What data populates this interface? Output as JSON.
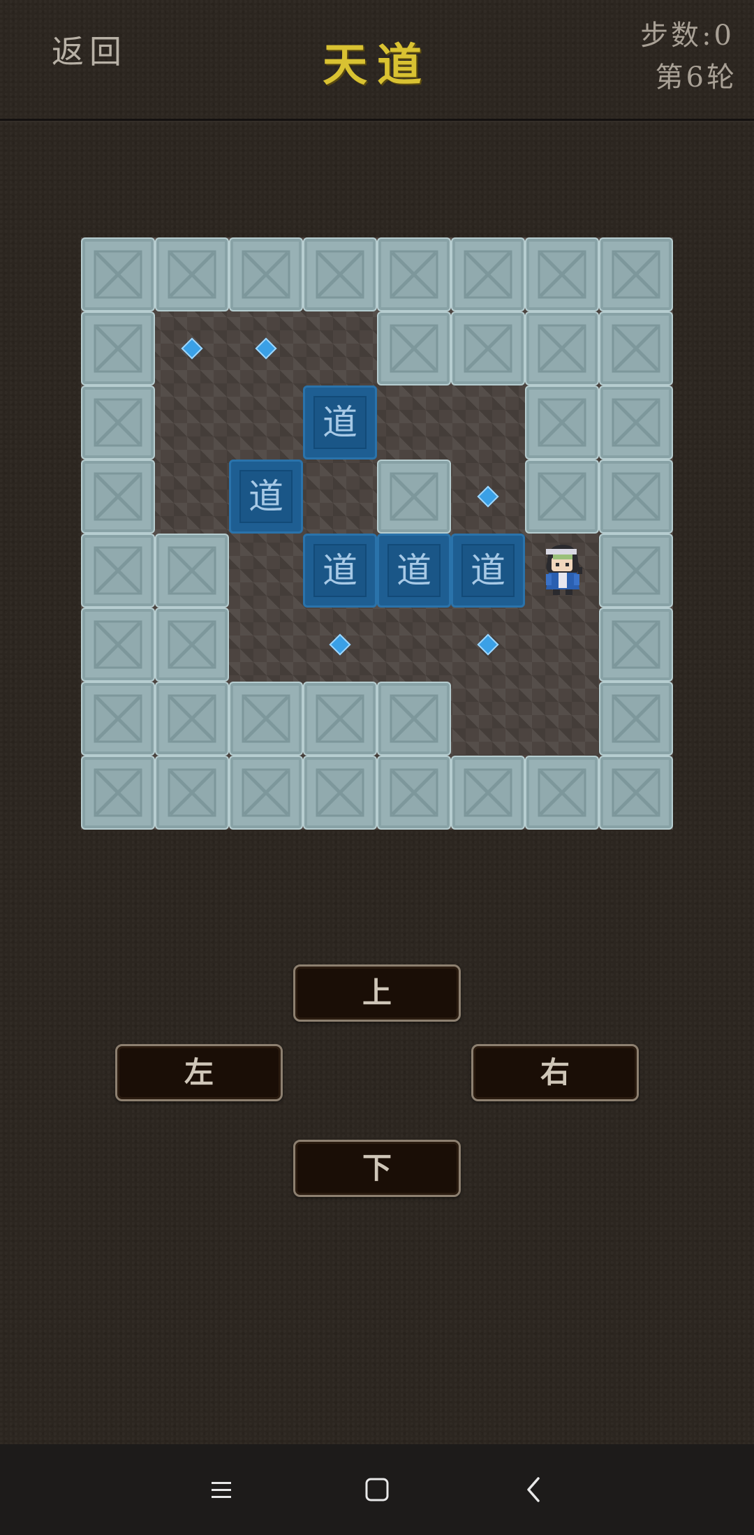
{
  "header": {
    "back_label": "返回",
    "title": "天道",
    "steps_label": "步数",
    "steps_value": "0",
    "round_label": "第6轮"
  },
  "board": {
    "cols": 8,
    "rows": 8,
    "box_label": "道",
    "walls": [
      [
        0,
        0
      ],
      [
        1,
        0
      ],
      [
        2,
        0
      ],
      [
        3,
        0
      ],
      [
        4,
        0
      ],
      [
        5,
        0
      ],
      [
        6,
        0
      ],
      [
        7,
        0
      ],
      [
        0,
        1
      ],
      [
        4,
        1
      ],
      [
        5,
        1
      ],
      [
        6,
        1
      ],
      [
        7,
        1
      ],
      [
        0,
        2
      ],
      [
        6,
        2
      ],
      [
        7,
        2
      ],
      [
        0,
        3
      ],
      [
        4,
        3
      ],
      [
        6,
        3
      ],
      [
        7,
        3
      ],
      [
        0,
        4
      ],
      [
        1,
        4
      ],
      [
        7,
        4
      ],
      [
        0,
        5
      ],
      [
        1,
        5
      ],
      [
        7,
        5
      ],
      [
        0,
        6
      ],
      [
        1,
        6
      ],
      [
        2,
        6
      ],
      [
        3,
        6
      ],
      [
        4,
        6
      ],
      [
        7,
        6
      ],
      [
        0,
        7
      ],
      [
        1,
        7
      ],
      [
        2,
        7
      ],
      [
        3,
        7
      ],
      [
        4,
        7
      ],
      [
        5,
        7
      ],
      [
        6,
        7
      ],
      [
        7,
        7
      ]
    ],
    "targets": [
      [
        1,
        1
      ],
      [
        2,
        1
      ],
      [
        5,
        3
      ],
      [
        3,
        5
      ],
      [
        5,
        5
      ]
    ],
    "boxes": [
      [
        3,
        2
      ],
      [
        2,
        3
      ],
      [
        3,
        4
      ],
      [
        4,
        4
      ],
      [
        5,
        4
      ]
    ],
    "player": [
      6,
      4
    ],
    "colors": {
      "wall": "#98b1b5",
      "box": "#1e5e92",
      "target": "#3aa0e6",
      "title": "#d9c232"
    }
  },
  "controls": {
    "up": "上",
    "left": "左",
    "right": "右",
    "down": "下"
  },
  "system_nav": {
    "icons": [
      "menu-icon",
      "home-icon",
      "back-icon"
    ]
  }
}
